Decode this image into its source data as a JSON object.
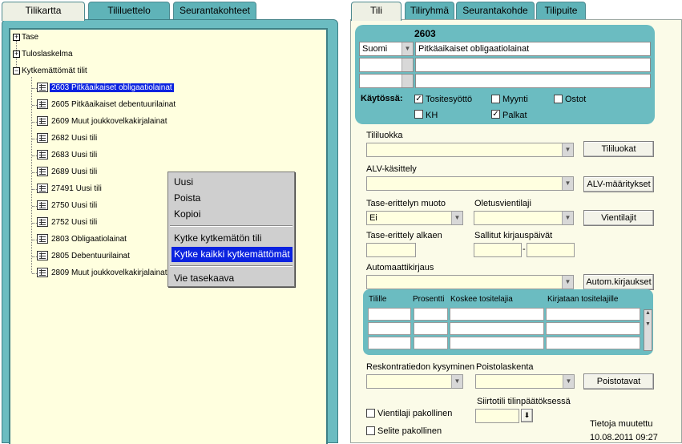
{
  "left_tabs": [
    "Tilikartta",
    "Tililuettelo",
    "Seurantakohteet"
  ],
  "right_tabs": [
    "Tili",
    "Tiliryhmä",
    "Seurantakohde",
    "Tilipuite"
  ],
  "tree": {
    "roots": [
      "Tase",
      "Tuloslaskelma",
      "Kytkemättömät tilit"
    ],
    "accounts": [
      "2603 Pitkäaikaiset obligaatiolainat",
      "2605 Pitkäaikaiset debentuurilainat",
      "2609 Muut joukkovelkakirjalainat",
      "2682 Uusi tili",
      "2683 Uusi tili",
      "2689 Uusi tili",
      "27491 Uusi tili",
      "2750 Uusi tili",
      "2752 Uusi tili",
      "2803 Obligaatiolainat",
      "2805 Debentuurilainat",
      "2809 Muut joukkovelkakirjalainat"
    ]
  },
  "context_menu": {
    "items": [
      "Uusi",
      "Poista",
      "Kopioi",
      "Kytke kytkemätön tili",
      "Kytke kaikki kytkemättömät",
      "Vie tasekaava"
    ]
  },
  "account": {
    "number": "2603",
    "language": "Suomi",
    "name": "Pitkäaikaiset obligaatiolainat",
    "usage_label": "Käytössä:",
    "checks": [
      {
        "label": "Tositesyöttö",
        "checked": true
      },
      {
        "label": "Myynti",
        "checked": false
      },
      {
        "label": "Ostot",
        "checked": false
      },
      {
        "label": "KH",
        "checked": false
      },
      {
        "label": "Palkat",
        "checked": true
      }
    ]
  },
  "form": {
    "tililuokka_label": "Tililuokka",
    "tililuokat_button": "Tililuokat",
    "alv_label": "ALV-käsittely",
    "alv_button": "ALV-määritykset",
    "tase_muoto_label": "Tase-erittelyn muoto",
    "tase_muoto_value": "Ei",
    "oletusvientilaji_label": "Oletusvientilaji",
    "vientilajit_button": "Vientilajit",
    "tase_alkaen_label": "Tase-erittely alkaen",
    "sallitut_label": "Sallitut kirjauspäivät",
    "range_sep": "-",
    "automaattikirjaus_label": "Automaattikirjaus",
    "autom_button": "Autom.kirjaukset",
    "grid_headers": [
      "Tilille",
      "Prosentti",
      "Koskee tositelajia",
      "Kirjataan tositelajille"
    ],
    "reskontra_label": "Reskontratiedon kysyminen",
    "poistolaskenta_label": "Poistolaskenta",
    "poistotavat_button": "Poistotavat",
    "siirtotili_label": "Siirtotili tilinpäätöksessä",
    "vientilaji_pakollinen": "Vientilaji pakollinen",
    "selite_pakollinen": "Selite pakollinen",
    "tietoja_muutettu_label": "Tietoja muutettu",
    "tietoja_muutettu_value": "10.08.2011 09:27"
  }
}
